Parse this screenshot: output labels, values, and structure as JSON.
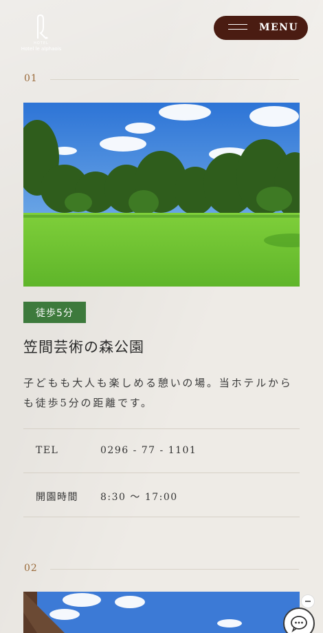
{
  "header": {
    "logo_small": "HOTEL",
    "logo_name": "Hotel le alphaois",
    "menu_label": "MENU"
  },
  "sections": [
    {
      "number": "01",
      "badge": "徒歩5分",
      "title": "笠間芸術の森公園",
      "description": "子どもも大人も楽しめる憩いの場。当ホテルからも徒歩5分の距離です。",
      "info": [
        {
          "label": "TEL",
          "value": "0296 - 77 - 1101"
        },
        {
          "label": "開園時間",
          "value": "8:30 〜 17:00"
        }
      ]
    },
    {
      "number": "02"
    }
  ],
  "icons": {
    "chat": "chat-bubble-icon",
    "close": "close-icon",
    "menu": "hamburger-icon"
  }
}
